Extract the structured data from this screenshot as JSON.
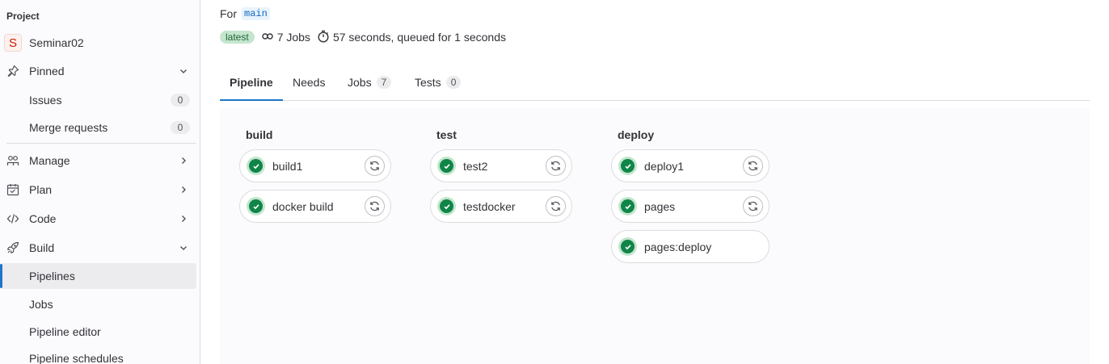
{
  "sidebar": {
    "section_title": "Project",
    "project": {
      "avatar_letter": "S",
      "name": "Seminar02"
    },
    "pinned": {
      "label": "Pinned",
      "icon": "thumbtack-icon"
    },
    "pinned_items": [
      {
        "label": "Issues",
        "count": "0"
      },
      {
        "label": "Merge requests",
        "count": "0"
      }
    ],
    "groups": [
      {
        "label": "Manage",
        "icon": "users-icon"
      },
      {
        "label": "Plan",
        "icon": "calendar-icon"
      },
      {
        "label": "Code",
        "icon": "code-icon"
      },
      {
        "label": "Build",
        "icon": "rocket-icon"
      }
    ],
    "build_items": [
      {
        "label": "Pipelines",
        "active": true
      },
      {
        "label": "Jobs"
      },
      {
        "label": "Pipeline editor"
      },
      {
        "label": "Pipeline schedules"
      }
    ]
  },
  "header": {
    "for_label": "For",
    "branch": "main",
    "latest_badge": "latest",
    "jobs_summary": "7 Jobs",
    "duration": "57 seconds, queued for 1 seconds"
  },
  "tabs": [
    {
      "label": "Pipeline",
      "active": true
    },
    {
      "label": "Needs"
    },
    {
      "label": "Jobs",
      "count": "7"
    },
    {
      "label": "Tests",
      "count": "0"
    }
  ],
  "stages": [
    {
      "name": "build",
      "jobs": [
        {
          "name": "build1",
          "status": "success",
          "retry": true
        },
        {
          "name": "docker build",
          "status": "success",
          "retry": true
        }
      ]
    },
    {
      "name": "test",
      "jobs": [
        {
          "name": "test2",
          "status": "success",
          "retry": true
        },
        {
          "name": "testdocker",
          "status": "success",
          "retry": true
        }
      ]
    },
    {
      "name": "deploy",
      "jobs": [
        {
          "name": "deploy1",
          "status": "success",
          "retry": true
        },
        {
          "name": "pages",
          "status": "success",
          "retry": true
        },
        {
          "name": "pages:deploy",
          "status": "success",
          "retry": false
        }
      ]
    }
  ],
  "colors": {
    "accent": "#1f75cb",
    "success": "#108548",
    "success_bg": "#c3e6cd"
  }
}
